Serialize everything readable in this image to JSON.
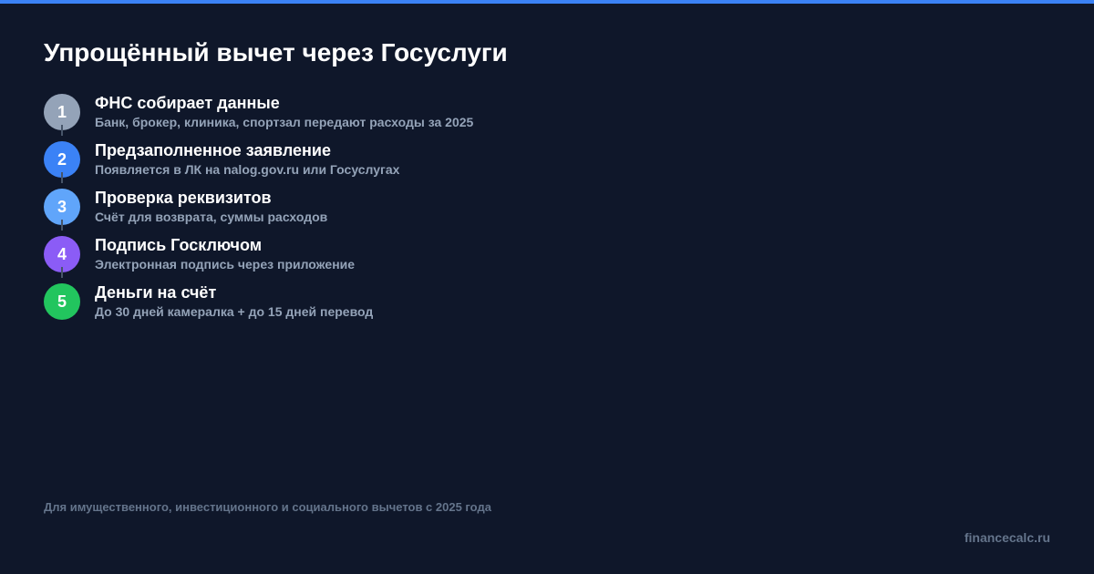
{
  "title": "Упрощённый вычет через Госуслуги",
  "accent_color": "#3b82f6",
  "background_color": "#0f172a",
  "steps": [
    {
      "number": "1",
      "title": "ФНС собирает данные",
      "description": "Банк, брокер, клиника, спортзал передают расходы за 2025",
      "color": "#94a3b8"
    },
    {
      "number": "2",
      "title": "Предзаполненное заявление",
      "description": "Появляется в ЛК на nalog.gov.ru или Госуслугах",
      "color": "#3b82f6"
    },
    {
      "number": "3",
      "title": "Проверка реквизитов",
      "description": "Счёт для возврата, суммы расходов",
      "color": "#60a5fa"
    },
    {
      "number": "4",
      "title": "Подпись Госключом",
      "description": "Электронная подпись через приложение",
      "color": "#8b5cf6"
    },
    {
      "number": "5",
      "title": "Деньги на счёт",
      "description": "До 30 дней камералка + до 15 дней перевод",
      "color": "#22c55e"
    }
  ],
  "footnote": "Для имущественного, инвестиционного и социального вычетов с 2025 года",
  "brand": "financecalc.ru"
}
